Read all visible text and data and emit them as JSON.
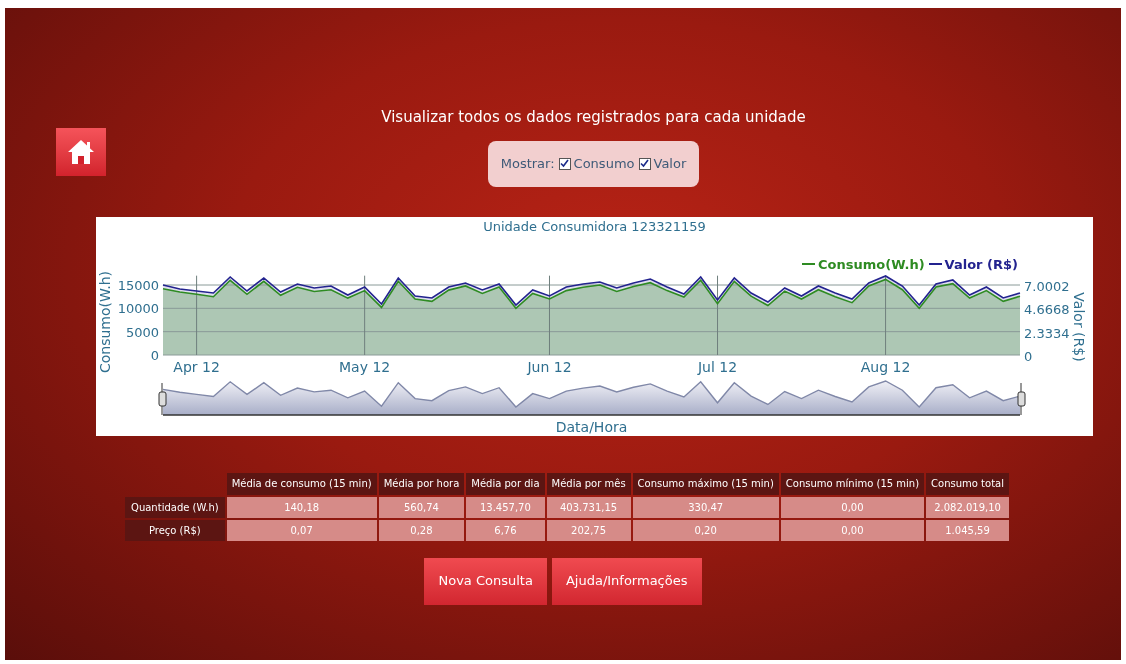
{
  "home_button": {
    "kind": "home"
  },
  "title": "Visualizar todos os dados registrados para cada unidade",
  "filter": {
    "label": "Mostrar:",
    "options": [
      {
        "label": "Consumo",
        "checked": true
      },
      {
        "label": "Valor",
        "checked": true
      }
    ]
  },
  "chart": {
    "chart_data": {
      "type": "area",
      "title": "Unidade Consumidora 123321159",
      "xlabel": "Data/Hora",
      "ylabel": "Consumo(W.h)",
      "y2label": "Valor (R$)",
      "categories": [
        null,
        null,
        "Apr 12",
        null,
        null,
        null,
        null,
        null,
        null,
        null,
        null,
        null,
        "May 12",
        null,
        null,
        null,
        null,
        null,
        null,
        null,
        null,
        null,
        null,
        "Jun 12",
        null,
        null,
        null,
        null,
        null,
        null,
        null,
        null,
        null,
        "Jul 12",
        null,
        null,
        null,
        null,
        null,
        null,
        null,
        null,
        null,
        "Aug 12",
        null,
        null,
        null,
        null,
        null,
        null,
        null,
        null
      ],
      "ylim": [
        0,
        17000
      ],
      "y2lim": [
        0,
        7.9336
      ],
      "grid": true,
      "legend": true,
      "yticks": [
        0,
        5000,
        10000,
        15000
      ],
      "y2ticks": [
        {
          "value": 0,
          "label": "0"
        },
        {
          "value": 2.3334,
          "label": "2.3334"
        },
        {
          "value": 4.6668,
          "label": "4.6668"
        },
        {
          "value": 7.0002,
          "label": "7.0002"
        }
      ],
      "series": [
        {
          "name": "Consumo(W.h)",
          "color": "#2e8b22",
          "values": [
            14200,
            13500,
            13000,
            12500,
            16000,
            13000,
            15800,
            12800,
            14500,
            13600,
            14000,
            12200,
            13800,
            10200,
            15800,
            12000,
            11500,
            13900,
            14800,
            13200,
            14600,
            10000,
            13200,
            12000,
            13800,
            14500,
            15000,
            13600,
            14700,
            15500,
            13800,
            12400,
            16000,
            11000,
            15800,
            12600,
            10600,
            13700,
            12000,
            14000,
            12500,
            11200,
            14800,
            16200,
            14000,
            10000,
            14600,
            15300,
            12200,
            13800,
            11500,
            12600
          ]
        },
        {
          "name": "Valor (R$)",
          "color": "#23238f",
          "axis": "y2",
          "values": [
            7.0,
            6.6,
            6.4,
            6.2,
            7.8,
            6.4,
            7.7,
            6.3,
            7.1,
            6.7,
            6.9,
            6.0,
            6.8,
            5.1,
            7.7,
            5.9,
            5.7,
            6.8,
            7.2,
            6.5,
            7.1,
            5.0,
            6.5,
            5.9,
            6.8,
            7.1,
            7.3,
            6.7,
            7.2,
            7.6,
            6.8,
            6.1,
            7.8,
            5.5,
            7.7,
            6.2,
            5.3,
            6.7,
            5.9,
            6.9,
            6.2,
            5.6,
            7.2,
            7.9,
            6.9,
            5.0,
            7.1,
            7.5,
            6.0,
            6.8,
            5.7,
            6.2
          ]
        }
      ]
    }
  },
  "table": {
    "columns": [
      "Média de consumo (15 min)",
      "Média por hora",
      "Média por dia",
      "Média por mês",
      "Consumo máximo (15 min)",
      "Consumo mínimo (15 min)",
      "Consumo total"
    ],
    "rows": [
      {
        "label": "Quantidade (W.h)",
        "cells": [
          "140,18",
          "560,74",
          "13.457,70",
          "403.731,15",
          "330,47",
          "0,00",
          "2.082.019,10"
        ]
      },
      {
        "label": "Preço (R$)",
        "cells": [
          "0,07",
          "0,28",
          "6,76",
          "202,75",
          "0,20",
          "0,00",
          "1.045,59"
        ]
      }
    ]
  },
  "buttons": [
    "Nova Consulta",
    "Ajuda/Informações"
  ]
}
